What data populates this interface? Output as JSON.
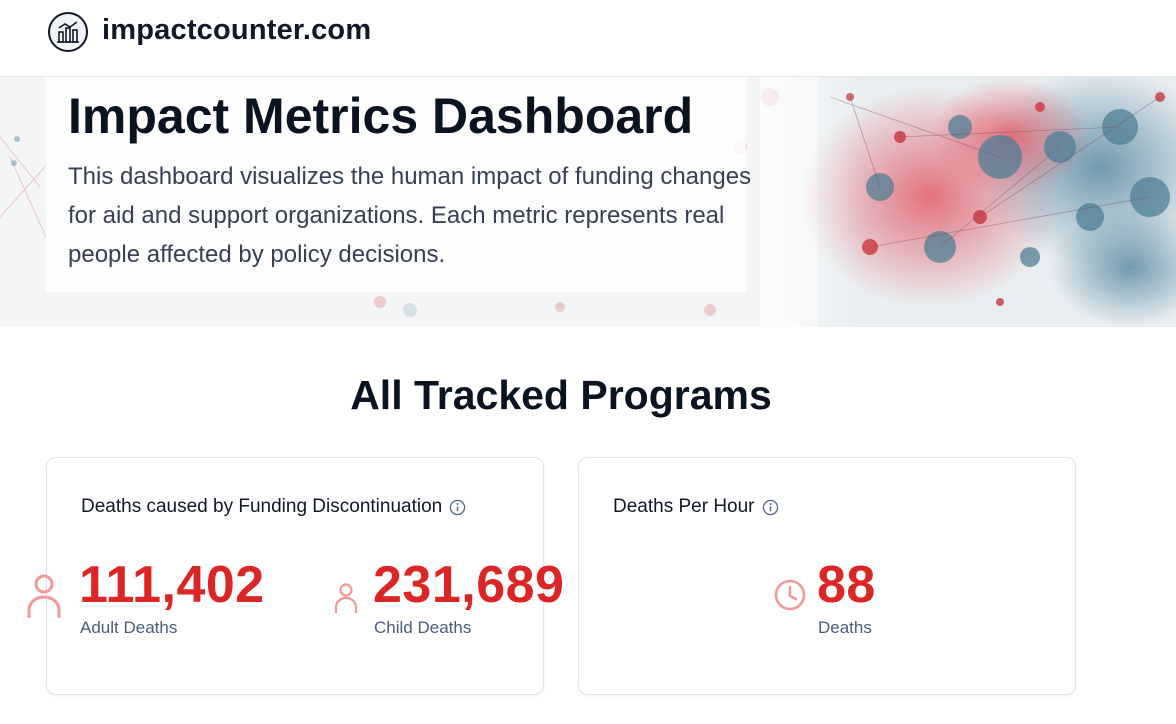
{
  "header": {
    "site_name": "impactcounter.com",
    "logo_icon": "building-chart-icon"
  },
  "hero": {
    "title": "Impact Metrics Dashboard",
    "description": "This dashboard visualizes the human impact of funding changes for aid and support organizations. Each metric represents real people affected by policy decisions."
  },
  "section": {
    "title": "All Tracked Programs"
  },
  "cards": [
    {
      "title": "Deaths caused by Funding Discontinuation",
      "info_icon": "info-icon",
      "metrics": [
        {
          "icon": "person-icon",
          "value": "111,402",
          "label": "Adult Deaths"
        },
        {
          "icon": "person-icon",
          "value": "231,689",
          "label": "Child Deaths"
        }
      ]
    },
    {
      "title": "Deaths Per Hour",
      "info_icon": "info-icon",
      "metrics": [
        {
          "icon": "clock-icon",
          "value": "88",
          "label": "Deaths"
        }
      ]
    }
  ],
  "colors": {
    "accent_red": "#dc2626",
    "icon_red_light": "#f19a9a",
    "label_slate": "#4b5d7a",
    "heading_dark": "#0b1220"
  }
}
